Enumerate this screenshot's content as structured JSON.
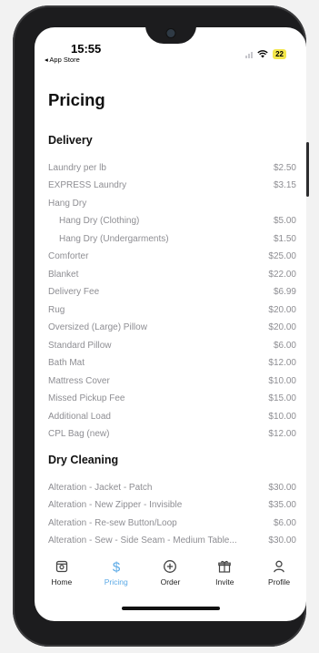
{
  "status_bar": {
    "time": "15:55",
    "back_label": "◂ App Store",
    "battery": "22"
  },
  "page": {
    "title": "Pricing"
  },
  "sections": [
    {
      "title": "Delivery",
      "items": [
        {
          "name": "Laundry per lb",
          "price": "$2.50"
        },
        {
          "name": "EXPRESS Laundry",
          "price": "$3.15"
        },
        {
          "name": "Hang Dry",
          "price": ""
        },
        {
          "name": "Hang Dry (Clothing)",
          "price": "$5.00"
        },
        {
          "name": "Hang Dry (Undergarments)",
          "price": "$1.50"
        },
        {
          "name": "Comforter",
          "price": "$25.00"
        },
        {
          "name": "Blanket",
          "price": "$22.00"
        },
        {
          "name": "Delivery Fee",
          "price": "$6.99"
        },
        {
          "name": "Rug",
          "price": "$20.00"
        },
        {
          "name": "Oversized (Large) Pillow",
          "price": "$20.00"
        },
        {
          "name": "Standard Pillow",
          "price": "$6.00"
        },
        {
          "name": "Bath Mat",
          "price": "$12.00"
        },
        {
          "name": "Mattress Cover",
          "price": "$10.00"
        },
        {
          "name": "Missed Pickup Fee",
          "price": "$15.00"
        },
        {
          "name": "Additional Load",
          "price": "$10.00"
        },
        {
          "name": "CPL Bag (new)",
          "price": "$12.00"
        }
      ]
    },
    {
      "title": "Dry Cleaning",
      "items": [
        {
          "name": "Alteration - Jacket - Patch",
          "price": "$30.00"
        },
        {
          "name": "Alteration - New Zipper - Invisible",
          "price": "$35.00"
        },
        {
          "name": "Alteration - Re-sew Button/Loop",
          "price": "$6.00"
        },
        {
          "name": "Alteration - Sew - Side Seam - Medium Table...",
          "price": "$30.00"
        }
      ]
    }
  ],
  "tabs": [
    {
      "label": "Home",
      "icon": "home-icon"
    },
    {
      "label": "Pricing",
      "icon": "dollar-icon"
    },
    {
      "label": "Order",
      "icon": "plus-circle-icon"
    },
    {
      "label": "Invite",
      "icon": "gift-icon"
    },
    {
      "label": "Profile",
      "icon": "person-icon"
    }
  ],
  "colors": {
    "accent": "#5aa9e6",
    "battery": "#f3e64b",
    "muted_text": "#8e8e93"
  }
}
